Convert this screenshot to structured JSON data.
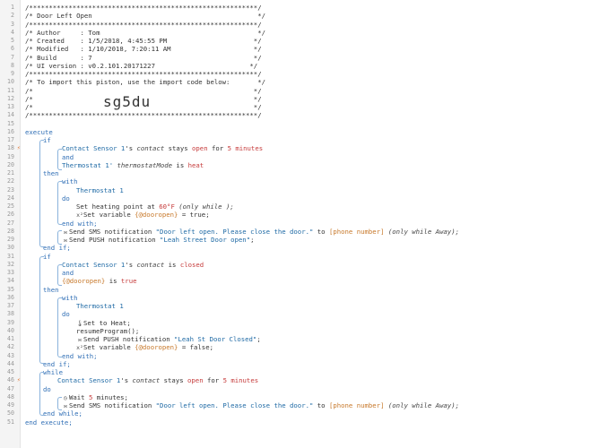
{
  "gutter": {
    "line_numbers": [
      "1",
      "2",
      "3",
      "4",
      "5",
      "6",
      "7",
      "8",
      "9",
      "10",
      "11",
      "12",
      "13",
      "14",
      "15",
      "16",
      "17",
      "18",
      "19",
      "20",
      "21",
      "22",
      "23",
      "24",
      "25",
      "26",
      "27",
      "28",
      "29",
      "30",
      "31",
      "32",
      "33",
      "34",
      "35",
      "36",
      "37",
      "38",
      "39",
      "40",
      "41",
      "42",
      "43",
      "44",
      "45",
      "46",
      "47",
      "48",
      "49",
      "50",
      "51"
    ]
  },
  "header": {
    "border": "/**********************************************************/",
    "title": "/* Door Left Open                                          */",
    "author": "/* Author     : Tom                                        */",
    "created": "/* Created    : 1/5/2018, 4:45:55 PM                      */",
    "modified": "/* Modified   : 1/10/2018, 7:20:11 AM                     */",
    "build": "/* Build      : 7                                         */",
    "ui_version": "/* UI version : v0.2.101.20171227                        */",
    "import": "/* To import this piston, use the import code below:       */",
    "blank": "/*                                                        */",
    "import_code": "sg5du"
  },
  "code": {
    "execute": "execute",
    "if": "if",
    "then": "then",
    "with": "with",
    "do": "do",
    "and": "and",
    "end_with": "end with;",
    "end_if": "end if;",
    "while": "while",
    "end_while": "end while;",
    "end_execute": "end execute;",
    "contact_sensor": "Contact Sensor 1",
    "thermostat": "Thermostat 1",
    "s_contact": "'s ",
    "contact_attr": "contact",
    "stays": " stays ",
    "open": "open",
    "for": " for ",
    "five": "5",
    "minutes": " minutes",
    "is": " is ",
    "closed": "closed",
    "thermostat_s": "Thermostat 1'",
    "thermostat_mode": " thermostatMode",
    "heat": "heat",
    "set_heating_point": "Set heating point at ",
    "sixty": "60°F",
    "only_while_open": "(only while );",
    "set_variable": "Set variable ",
    "dooropen": "{@dooropen}",
    "eq_true": " = true;",
    "eq_false": " = false;",
    "true": "true",
    "send_sms": "Send SMS notification ",
    "sms_msg": "\"Door left open. Please close the door.\"",
    "to": " to ",
    "phone": "[phone number]",
    "only_while": "(only while ",
    "away": "Away",
    "paren_end": ");",
    "send_push": "Send PUSH notification ",
    "push_msg1": "\"Leah Street Door open\"",
    "semi": ";",
    "set_to_heat": "Set to Heat;",
    "resume_program": "resumeProgram();",
    "push_msg2": "\"Leah St Door Closed\"",
    "wait": "Wait ",
    "minutes_semi": " minutes;",
    "minutes_for": " minutes"
  },
  "icons": {
    "sms": "message-icon",
    "push": "message-icon",
    "variable": "variable-icon",
    "heat": "thermometer-icon",
    "wait": "clock-icon",
    "marker": "flag-icon"
  },
  "colors": {
    "keyword": "#2f6eb5",
    "device": "#1f6aa5",
    "value": "#c63b3b",
    "variable": "#c7782a"
  }
}
